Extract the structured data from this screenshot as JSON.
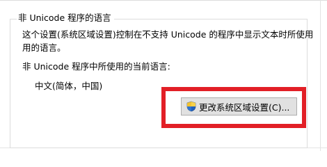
{
  "group": {
    "title": "非 Unicode 程序的语言",
    "description_line1": "这个设置(系统区域设置)控制在不支持 Unicode 的程序中显示文本时所使用",
    "description_line2": "用的语言。",
    "current_label": "非 Unicode 程序中所使用的当前语言:",
    "current_value": "中文(简体，中国)",
    "change_button_label": "更改系统区域设置(C)..."
  },
  "icons": {
    "change_button_icon": "uac-shield-icon"
  },
  "colors": {
    "highlight_border": "#e21f26",
    "button_bg": "#e1e1e1",
    "groupbox_border": "#dcdcdc"
  }
}
